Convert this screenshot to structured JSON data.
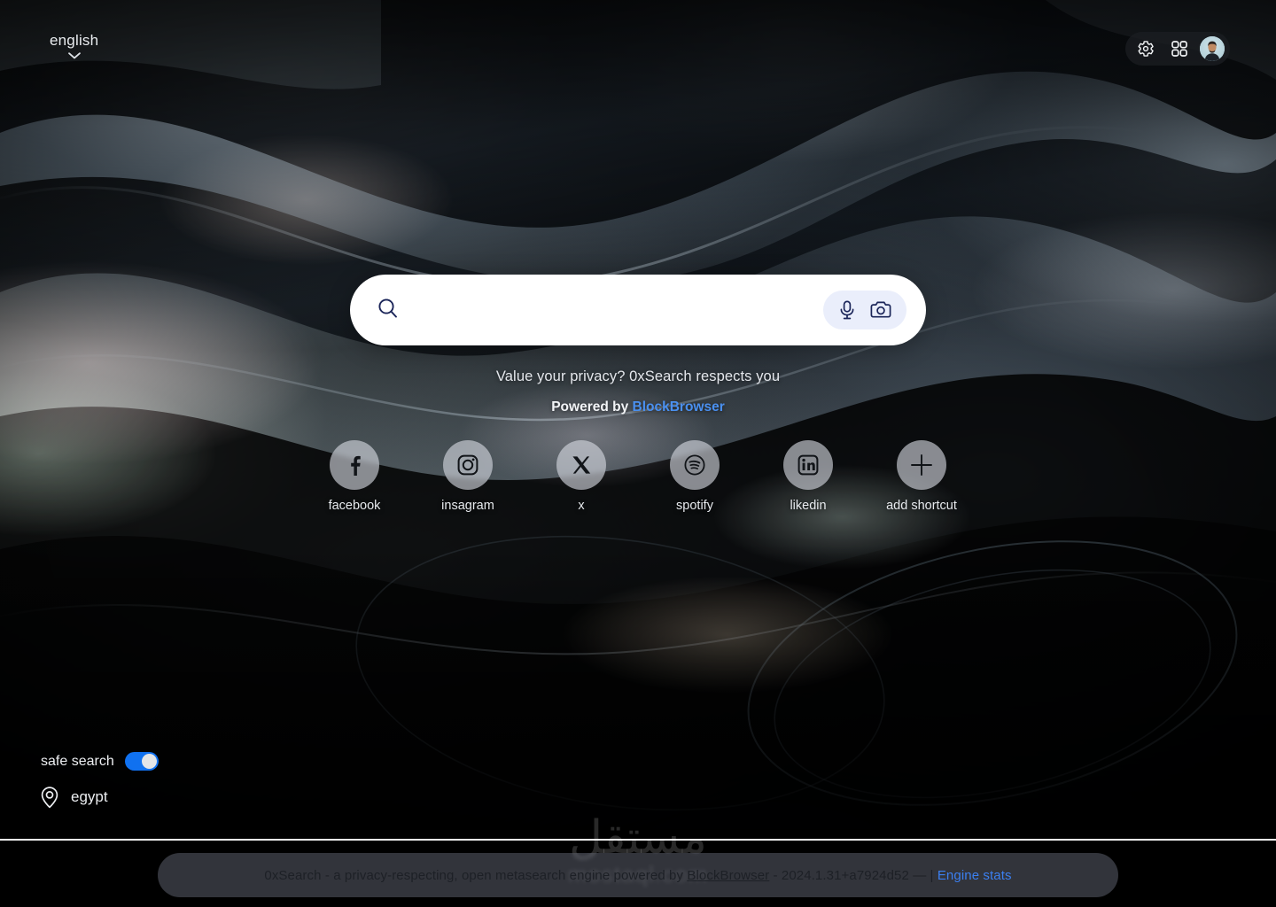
{
  "header": {
    "language": {
      "label": "english",
      "chevron_icon": "chevron-down-icon"
    },
    "actions": {
      "settings_icon": "gear-icon",
      "apps_icon": "apps-grid-icon",
      "avatar_icon": "user-avatar"
    }
  },
  "search": {
    "search_icon": "search-icon",
    "value": "",
    "placeholder": "",
    "voice_icon": "microphone-icon",
    "lens_icon": "camera-icon"
  },
  "hero": {
    "tagline": "Value your privacy? 0xSearch respects you",
    "powered_prefix": "Powered by ",
    "powered_brand": "BlockBrowser"
  },
  "shortcuts": [
    {
      "label": "facebook",
      "icon": "facebook-icon"
    },
    {
      "label": "insagram",
      "icon": "instagram-icon"
    },
    {
      "label": "x",
      "icon": "x-twitter-icon"
    },
    {
      "label": "spotify",
      "icon": "spotify-icon"
    },
    {
      "label": "likedin",
      "icon": "linkedin-icon"
    },
    {
      "label": "add shortcut",
      "icon": "plus-icon"
    }
  ],
  "controls": {
    "safe_search_label": "safe search",
    "safe_search_on": true,
    "location_icon": "location-pin-icon",
    "location_label": "egypt"
  },
  "watermark": {
    "arabic": "مستقل",
    "latin": "mostaql.com"
  },
  "footer": {
    "text_before": "0xSearch - a privacy-respecting, open metasearch engine powered by ",
    "brand": "BlockBrowser",
    "version": " - 2024.1.31+a7924d52 — | ",
    "engine_stats": "Engine stats"
  },
  "colors": {
    "accent_blue": "#3b7ff0",
    "toggle_on": "#1071f0",
    "search_navy": "#1b2559",
    "media_pill": "#eaeefb"
  }
}
